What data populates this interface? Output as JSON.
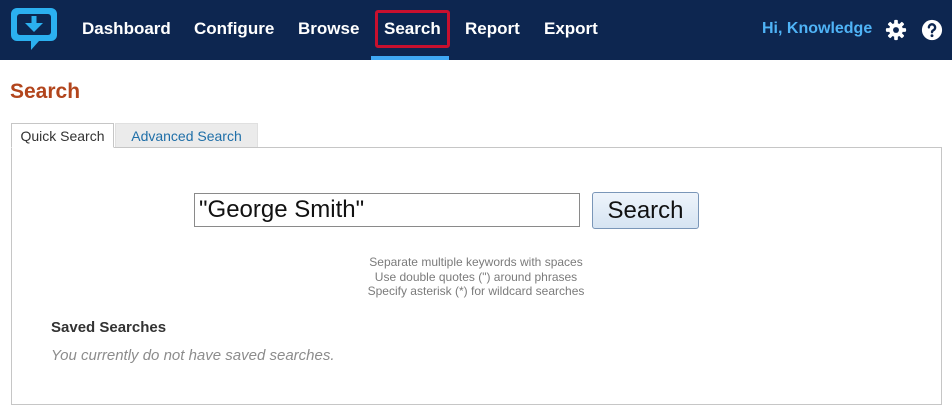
{
  "header": {
    "logo": "app-logo-icon",
    "nav": [
      {
        "label": "Dashboard"
      },
      {
        "label": "Configure"
      },
      {
        "label": "Browse"
      },
      {
        "label": "Search",
        "active": true
      },
      {
        "label": "Report"
      },
      {
        "label": "Export"
      }
    ],
    "greeting": "Hi, Knowledge",
    "settings_icon": "gear-icon",
    "help_icon": "question-circle-icon",
    "colors": {
      "bar": "#0d2650",
      "highlight_box": "#c8102e",
      "underline": "#3fa9f5",
      "greeting": "#4fb3f6"
    }
  },
  "page": {
    "title": "Search",
    "tabs": [
      {
        "label": "Quick Search",
        "active": true
      },
      {
        "label": "Advanced Search",
        "active": false
      }
    ],
    "search": {
      "value": "\"George Smith\"",
      "button_label": "Search"
    },
    "hints": [
      "Separate multiple keywords with spaces",
      "Use double quotes (\") around phrases",
      "Specify asterisk (*) for wildcard searches"
    ],
    "saved_searches": {
      "title": "Saved Searches",
      "empty_text": "You currently do not have saved searches."
    }
  }
}
